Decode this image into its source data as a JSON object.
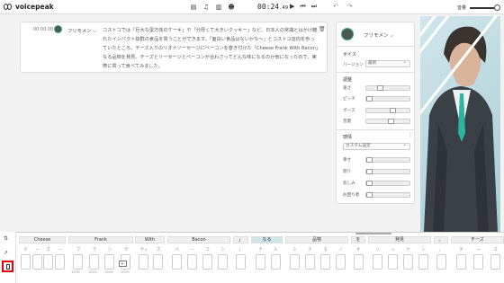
{
  "app": {
    "name": "voicepeak"
  },
  "toolbar": {
    "time_main": "00:24",
    "time_frac": ".49",
    "icons": [
      "file-icon",
      "music-icon",
      "dictionary-icon",
      "face-icon"
    ],
    "volume_label": "音量"
  },
  "editor": {
    "row": {
      "time": "00:00.00",
      "speaker": "フリモメン ⌵",
      "text": "コストコでは「巨大な蛋方体のケーキ」や「分厚くて大きいクッキー」など、日本人の常識とはかけ離れたインパクト抜群の食品を買うことができます。「面白い食品はないかな〜」とコストコ店内を歩っていたところ、チーズ入りのリオナソーセージにベーコンを巻き付けた「Cheese Frank With Bacon」なる品物を発見。チーズとリーセージとベーコンが合わさってどんな味になるのか気になったので、実際に買って食べてみました。"
    }
  },
  "panel": {
    "speaker": "フリモメン ⌵",
    "voice_heading": "ボイス",
    "version_label": "バージョン",
    "version_value": "最新",
    "params_heading": "調整",
    "params": [
      {
        "label": "速さ",
        "value": 0.45
      },
      {
        "label": "ピッチ",
        "value": 0.5
      },
      {
        "label": "ポーズ",
        "value": 0.55
      },
      {
        "label": "音量",
        "value": 0.5
      }
    ],
    "emotion_heading": "感情",
    "emotion_preset": "カスタム設定",
    "emotions": [
      {
        "label": "幸せ",
        "value": 0.0
      },
      {
        "label": "怒り",
        "value": 0.0
      },
      {
        "label": "悲しみ",
        "value": 0.0
      },
      {
        "label": "お困り者",
        "value": 0.0
      }
    ]
  },
  "timeline": {
    "groups": [
      {
        "label": "Cheese",
        "chars": [
          "チ",
          "ー",
          "ズ",
          "ー"
        ]
      },
      {
        "label": "Frank",
        "chars": [
          "フ",
          "ラ",
          "ン",
          "ク"
        ]
      },
      {
        "label": "With",
        "chars": [
          "ウィ",
          "ズ"
        ]
      },
      {
        "label": "Bacon",
        "chars": [
          "ベ",
          "ー",
          "コ",
          "ン"
        ]
      },
      {
        "label": "」",
        "chars": [
          "」"
        ]
      },
      {
        "label": "なる",
        "chars": [
          "ナ",
          "ル"
        ]
      },
      {
        "label": "品物",
        "chars": [
          "シ",
          "ナ",
          "モ",
          "ノ"
        ]
      },
      {
        "label": "を",
        "chars": [
          "オ"
        ]
      },
      {
        "label": "発見",
        "chars": [
          "ハ",
          "ッ",
          "ケ",
          "ン"
        ]
      },
      {
        "label": "。",
        "chars": [
          "。"
        ]
      },
      {
        "label": "チーズ",
        "chars": [
          "チ",
          "ー",
          "ズ"
        ]
      }
    ],
    "pct_labels": [
      "100%",
      "100%",
      "100%",
      "100%"
    ],
    "stepper_label": "+-"
  }
}
